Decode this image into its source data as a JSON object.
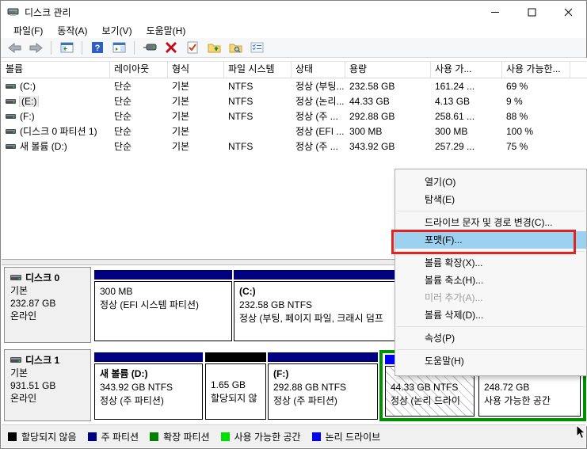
{
  "window": {
    "title": "디스크 관리"
  },
  "menu_bar": {
    "items": [
      "파일(F)",
      "동작(A)",
      "보기(V)",
      "도움말(H)"
    ]
  },
  "toolbar": {
    "icons": [
      "back",
      "forward",
      "console-tree",
      "help",
      "action-pane",
      "drive-properties",
      "delete-volume",
      "check-document",
      "open-folder",
      "explore-folder",
      "view-options"
    ]
  },
  "volume_table": {
    "columns": [
      "볼륨",
      "레이아웃",
      "형식",
      "파일 시스템",
      "상태",
      "용량",
      "사용 가...",
      "사용 가능한..."
    ],
    "rows": [
      {
        "volume": "(C:)",
        "layout": "단순",
        "type": "기본",
        "fs": "NTFS",
        "status": "정상 (부팅...",
        "capacity": "232.58 GB",
        "free": "161.24 ...",
        "pct": "69 %"
      },
      {
        "volume": "(E:)",
        "layout": "단순",
        "type": "기본",
        "fs": "NTFS",
        "status": "정상 (논리...",
        "capacity": "44.33 GB",
        "free": "4.13 GB",
        "pct": "9 %"
      },
      {
        "volume": "(F:)",
        "layout": "단순",
        "type": "기본",
        "fs": "NTFS",
        "status": "정상 (주 ...",
        "capacity": "292.88 GB",
        "free": "258.61 ...",
        "pct": "88 %"
      },
      {
        "volume": "(디스크 0 파티션 1)",
        "layout": "단순",
        "type": "기본",
        "fs": "",
        "status": "정상 (EFI ...",
        "capacity": "300 MB",
        "free": "300 MB",
        "pct": "100 %"
      },
      {
        "volume": "새 볼륨 (D:)",
        "layout": "단순",
        "type": "기본",
        "fs": "NTFS",
        "status": "정상 (주 ...",
        "capacity": "343.92 GB",
        "free": "257.29 ...",
        "pct": "75 %"
      }
    ]
  },
  "disks": [
    {
      "name": "디스크 0",
      "kind": "기본",
      "size": "232.87 GB",
      "status": "온라인",
      "partitions": [
        {
          "title": "",
          "size": "300 MB",
          "status": "정상 (EFI 시스템 파티션)"
        },
        {
          "title": "(C:)",
          "size": "232.58 GB NTFS",
          "status": "정상 (부팅, 페이지 파일, 크래시 덤프"
        }
      ]
    },
    {
      "name": "디스크 1",
      "kind": "기본",
      "size": "931.51 GB",
      "status": "온라인",
      "partitions": [
        {
          "title": "새 볼륨  (D:)",
          "size": "343.92 GB NTFS",
          "status": "정상 (주 파티션)"
        },
        {
          "title": "",
          "size": "1.65 GB",
          "status": "할당되지 않"
        },
        {
          "title": "(F:)",
          "size": "292.88 GB NTFS",
          "status": "정상 (주 파티션)"
        },
        {
          "title": "",
          "size": "44.33 GB NTFS",
          "status": "정상 (논리 드라이"
        },
        {
          "title": "",
          "size": "248.72 GB",
          "status": "사용 가능한 공간"
        }
      ]
    }
  ],
  "context_menu": {
    "items": [
      "열기(O)",
      "탐색(E)",
      "드라이브 문자 및 경로 변경(C)...",
      "포맷(F)...",
      "볼륨 확장(X)...",
      "볼륨 축소(H)...",
      "미러 추가(A)...",
      "볼륨 삭제(D)...",
      "속성(P)",
      "도움말(H)"
    ],
    "highlighted": "포맷(F)...",
    "disabled": "미러 추가(A)..."
  },
  "legend": {
    "items": [
      {
        "label": "할당되지 않음",
        "color": "#000000"
      },
      {
        "label": "주 파티션",
        "color": "#000080"
      },
      {
        "label": "확장 파티션",
        "color": "#008000"
      },
      {
        "label": "사용 가능한 공간",
        "color": "#00e000"
      },
      {
        "label": "논리 드라이브",
        "color": "#0000f0"
      }
    ]
  }
}
